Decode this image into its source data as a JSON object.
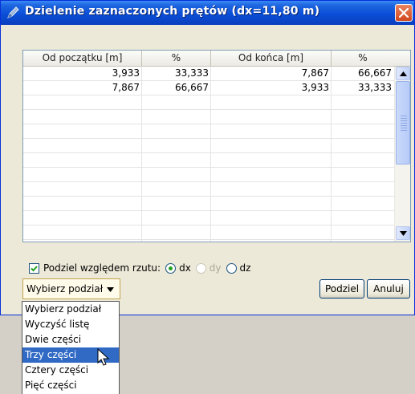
{
  "window": {
    "title": "Dzielenie zaznaczonych prętów (dx=11,80 m)",
    "icon": "pencil-icon",
    "close_icon": "close-icon"
  },
  "table": {
    "columns": [
      "Od początku [m]",
      "%",
      "Od końca [m]",
      "%"
    ],
    "rows": [
      [
        "3,933",
        "33,333",
        "7,867",
        "66,667"
      ],
      [
        "7,867",
        "66,667",
        "3,933",
        "33,333"
      ]
    ]
  },
  "options": {
    "checkbox_label": "Podziel względem rzutu:",
    "checkbox_checked": true,
    "radios": [
      {
        "label": "dx",
        "selected": true,
        "enabled": true
      },
      {
        "label": "dy",
        "selected": false,
        "enabled": false
      },
      {
        "label": "dz",
        "selected": false,
        "enabled": true
      }
    ]
  },
  "combo": {
    "value": "Wybierz podział",
    "options": [
      "Wybierz podział",
      "Wyczyść listę",
      "Dwie części",
      "Trzy części",
      "Cztery części",
      "Pięć części"
    ],
    "highlighted": "Trzy części"
  },
  "buttons": {
    "split": "Podziel",
    "cancel": "Anuluj"
  },
  "colors": {
    "titlebar": "#0a4fd8",
    "selection": "#316ac5",
    "radio_dot": "#21a121"
  }
}
